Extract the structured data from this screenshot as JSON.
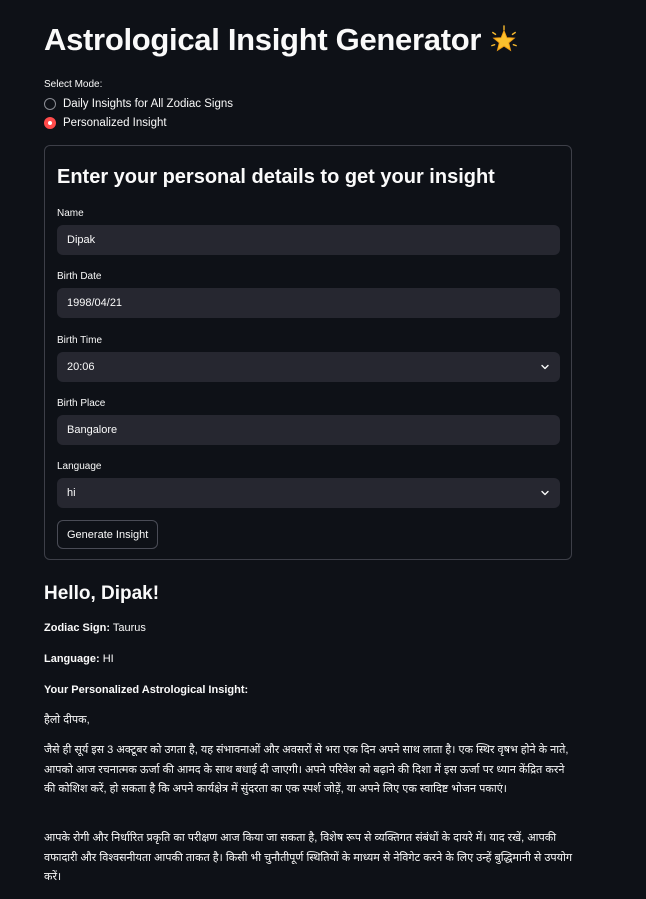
{
  "header": {
    "title": "Astrological Insight Generator",
    "icon": "glowing-star-icon"
  },
  "mode": {
    "label": "Select Mode:",
    "options": [
      {
        "label": "Daily Insights for All Zodiac Signs",
        "selected": false
      },
      {
        "label": "Personalized Insight",
        "selected": true
      }
    ]
  },
  "form": {
    "title": "Enter your personal details to get your insight",
    "name": {
      "label": "Name",
      "value": "Dipak"
    },
    "birth_date": {
      "label": "Birth Date",
      "value": "1998/04/21"
    },
    "birth_time": {
      "label": "Birth Time",
      "value": "20:06"
    },
    "birth_place": {
      "label": "Birth Place",
      "value": "Bangalore"
    },
    "language": {
      "label": "Language",
      "value": "hi"
    },
    "submit_label": "Generate Insight"
  },
  "result": {
    "greeting": "Hello, Dipak!",
    "zodiac_label": "Zodiac Sign:",
    "zodiac_value": "Taurus",
    "language_label": "Language:",
    "language_value": "HI",
    "insight_heading": "Your Personalized Astrological Insight:",
    "salutation": "हैलो दीपक,",
    "paragraph1": "जैसे ही सूर्य इस 3 अक्टूबर को उगता है, यह संभावनाओं और अवसरों से भरा एक दिन अपने साथ लाता है। एक स्थिर वृषभ होने के नाते, आपको आज रचनात्मक ऊर्जा की आमद के साथ बधाई दी जाएगी। अपने परिवेश को बढ़ाने की दिशा में इस ऊर्जा पर ध्यान केंद्रित करने की कोशिश करें, हो सकता है कि अपने कार्यक्षेत्र में सुंदरता का एक स्पर्श जोड़ें, या अपने लिए एक स्वादिष्ट भोजन पकाएं।",
    "paragraph2": "आपके रोगी और निर्धारित प्रकृति का परीक्षण आज किया जा सकता है, विशेष रूप से व्यक्तिगत संबंधों के दायरे में। याद रखें, आपकी वफादारी और विश्वसनीयता आपकी ताकत है। किसी भी चुनौतीपूर्ण स्थितियों के माध्यम से नेविगेट करने के लिए उन्हें बुद्धिमानी से उपयोग करें।"
  },
  "colors": {
    "background": "#0e1117",
    "input_bg": "#262730",
    "accent": "#ff4b4b"
  }
}
